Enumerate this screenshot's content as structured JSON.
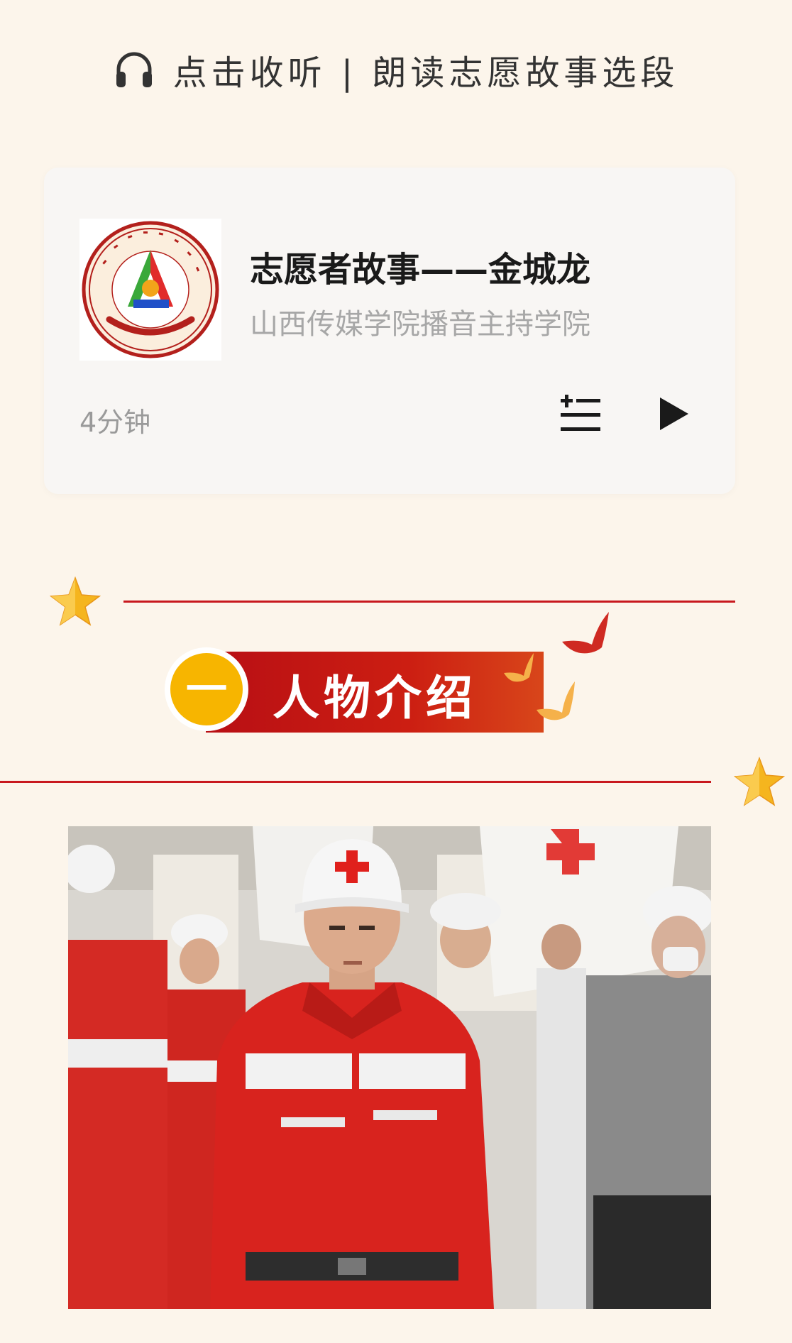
{
  "header": {
    "icon": "headphones-icon",
    "title": "点击收听 | 朗读志愿故事选段"
  },
  "audio_card": {
    "cover": {
      "logo_arc_text": "COMMUNICATION UNIVERSITY OF SHANXI",
      "logo_bottom_text": "山西传媒学院"
    },
    "title": "志愿者故事——金城龙",
    "subtitle": "山西传媒学院播音主持学院",
    "duration": "4分钟",
    "playlist_icon": "playlist-icon",
    "play_icon": "play-icon"
  },
  "section": {
    "number": "一",
    "label": "人物介绍"
  },
  "colors": {
    "background": "#fcf5eb",
    "card": "#f8f6f4",
    "accent_red": "#c8181e",
    "accent_gold": "#f7b500"
  }
}
